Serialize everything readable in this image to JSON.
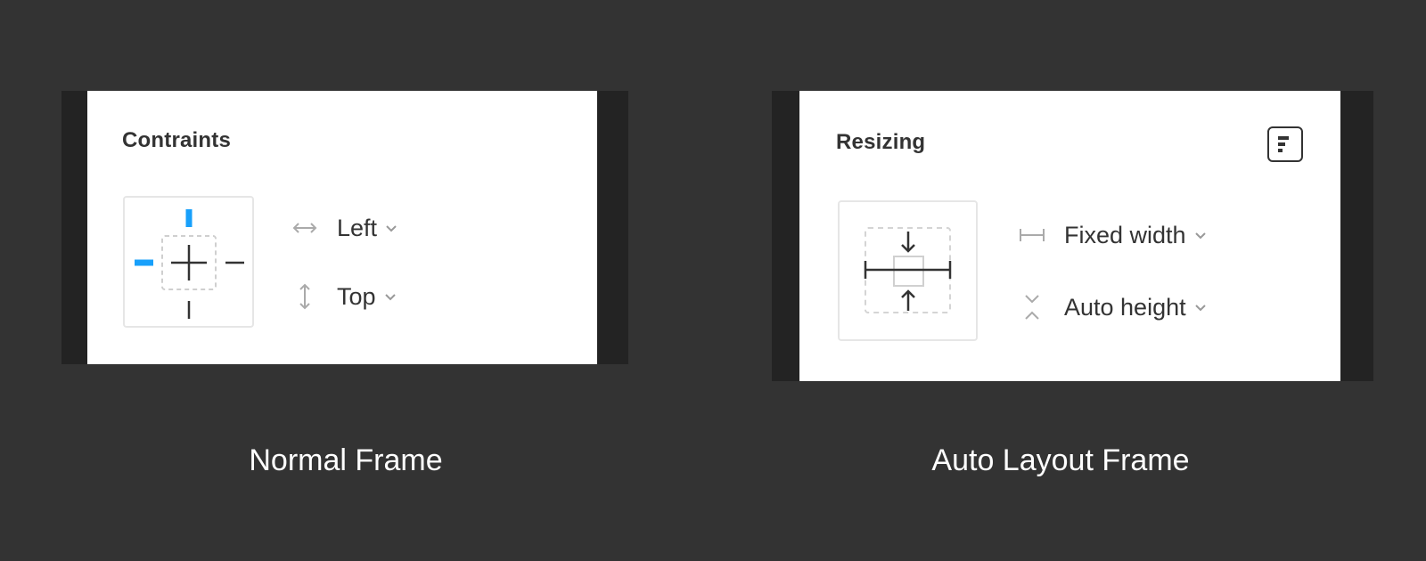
{
  "normal_frame": {
    "title": "Contraints",
    "horizontal": {
      "label": "Left",
      "icon": "horizontal-arrows-icon"
    },
    "vertical": {
      "label": "Top",
      "icon": "vertical-arrows-icon"
    },
    "caption": "Normal Frame",
    "active_constraints": [
      "top",
      "left"
    ],
    "accent_color": "#18a0fb"
  },
  "auto_layout_frame": {
    "title": "Resizing",
    "horizontal": {
      "label": "Fixed width",
      "icon": "fixed-width-icon"
    },
    "vertical": {
      "label": "Auto height",
      "icon": "hug-height-icon"
    },
    "caption": "Auto Layout Frame",
    "layout_icon": "align-left-icon"
  }
}
